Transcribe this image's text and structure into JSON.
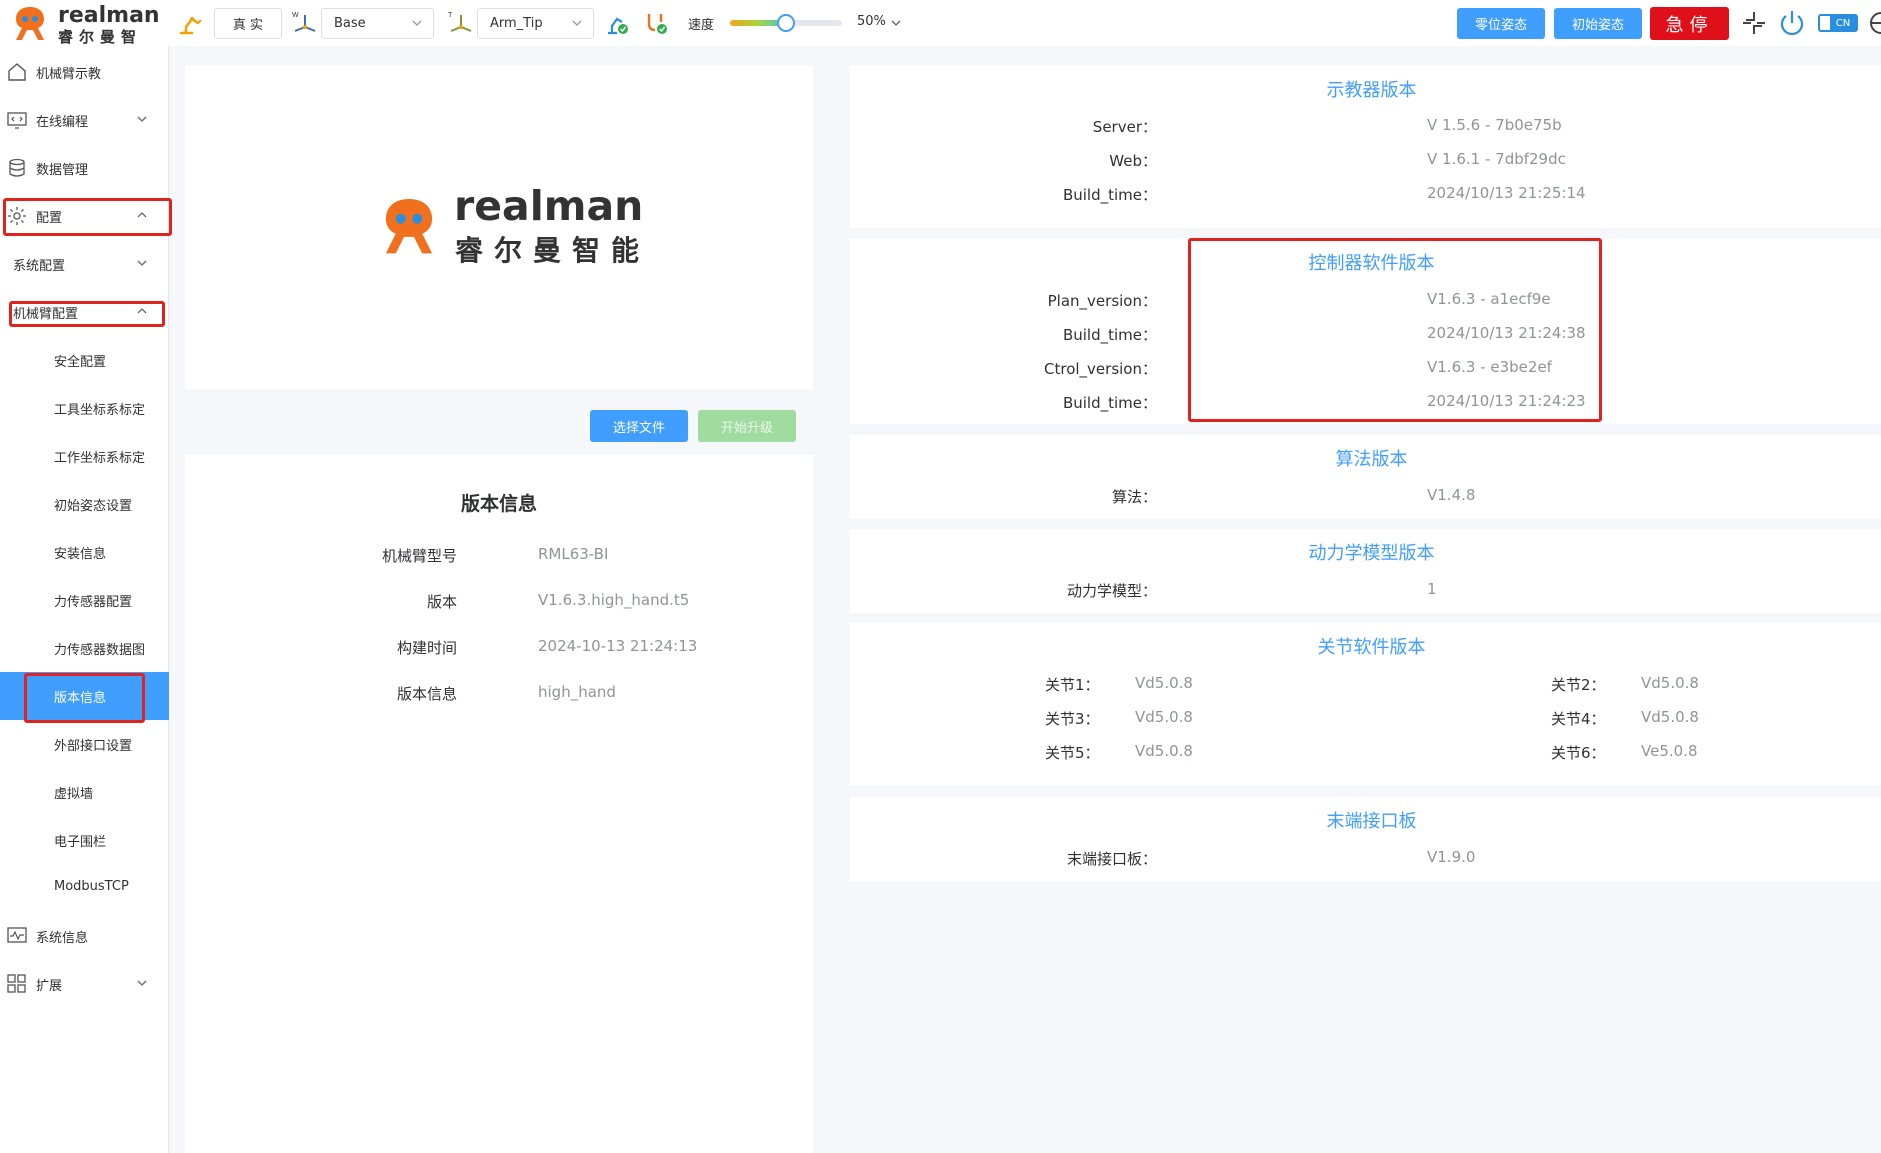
{
  "brand": {
    "name_en": "realman",
    "name_cn": "睿尔曼智能"
  },
  "toolbar": {
    "mode_label": "真 实",
    "base_select": {
      "value": "Base",
      "prefix": "W"
    },
    "tool_select": {
      "value": "Arm_Tip",
      "prefix": "T"
    },
    "speed_label": "速度",
    "speed_value": "50%",
    "speed_percent": 50,
    "zero_pose_label": "零位姿态",
    "initial_pose_label": "初始姿态",
    "estop_label": "急停",
    "lang_label": "CN"
  },
  "sidebar": {
    "items": [
      {
        "label": "机械臂示教"
      },
      {
        "label": "在线编程"
      },
      {
        "label": "数据管理"
      },
      {
        "label": "配置"
      },
      {
        "label": "系统配置"
      },
      {
        "label": "机械臂配置"
      },
      {
        "label": "安全配置"
      },
      {
        "label": "工具坐标系标定"
      },
      {
        "label": "工作坐标系标定"
      },
      {
        "label": "初始姿态设置"
      },
      {
        "label": "安装信息"
      },
      {
        "label": "力传感器配置"
      },
      {
        "label": "力传感器数据图"
      },
      {
        "label": "版本信息"
      },
      {
        "label": "外部接口设置"
      },
      {
        "label": "虚拟墙"
      },
      {
        "label": "电子围栏"
      },
      {
        "label": "ModbusTCP"
      },
      {
        "label": "系统信息"
      },
      {
        "label": "扩展"
      }
    ]
  },
  "main": {
    "select_file_label": "选择文件",
    "start_upgrade_label": "开始升级",
    "title": "版本信息",
    "rows": [
      {
        "key": "机械臂型号",
        "value": "RML63-BI"
      },
      {
        "key": "版本",
        "value": "V1.6.3.high_hand.t5"
      },
      {
        "key": "构建时间",
        "value": "2024-10-13 21:24:13"
      },
      {
        "key": "版本信息",
        "value": "high_hand"
      }
    ]
  },
  "sections": {
    "teach": {
      "title": "示教器版本",
      "rows": [
        {
          "key": "Server：",
          "value": "V 1.5.6 - 7b0e75b"
        },
        {
          "key": "Web：",
          "value": "V 1.6.1 - 7dbf29dc"
        },
        {
          "key": "Build_time：",
          "value": "2024/10/13 21:25:14"
        }
      ]
    },
    "controller": {
      "title": "控制器软件版本",
      "rows": [
        {
          "key": "Plan_version：",
          "value": "V1.6.3 - a1ecf9e"
        },
        {
          "key": "Build_time：",
          "value": "2024/10/13 21:24:38"
        },
        {
          "key": "Ctrol_version：",
          "value": "V1.6.3 - e3be2ef"
        },
        {
          "key": "Build_time：",
          "value": "2024/10/13 21:24:23"
        }
      ]
    },
    "algorithm": {
      "title": "算法版本",
      "rows": [
        {
          "key": "算法：",
          "value": "V1.4.8"
        }
      ]
    },
    "dynamics": {
      "title": "动力学模型版本",
      "rows": [
        {
          "key": "动力学模型：",
          "value": "1"
        }
      ]
    },
    "joints": {
      "title": "关节软件版本",
      "items": [
        {
          "key": "关节1：",
          "value": "Vd5.0.8"
        },
        {
          "key": "关节2：",
          "value": "Vd5.0.8"
        },
        {
          "key": "关节3：",
          "value": "Vd5.0.8"
        },
        {
          "key": "关节4：",
          "value": "Vd5.0.8"
        },
        {
          "key": "关节5：",
          "value": "Vd5.0.8"
        },
        {
          "key": "关节6：",
          "value": "Ve5.0.8"
        }
      ]
    },
    "end_board": {
      "title": "末端接口板",
      "rows": [
        {
          "key": "末端接口板：",
          "value": "V1.9.0"
        }
      ]
    }
  }
}
